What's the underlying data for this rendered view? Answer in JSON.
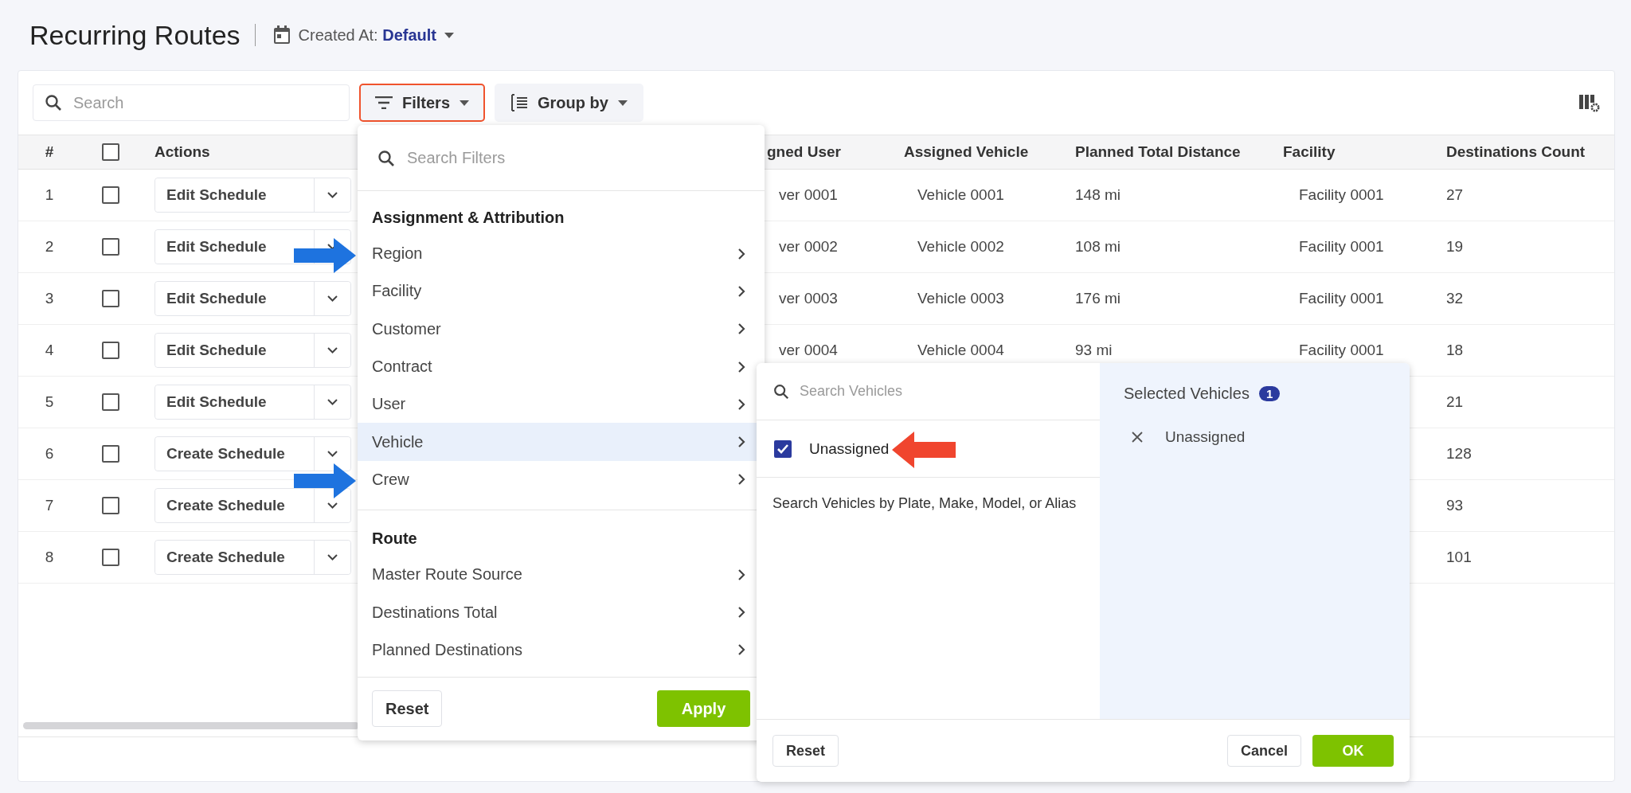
{
  "page": {
    "title": "Recurring Routes",
    "created_at": {
      "label": "Created At:",
      "value": "Default"
    }
  },
  "toolbar": {
    "search": {
      "placeholder": "Search"
    },
    "filters": {
      "label": "Filters",
      "open": true
    },
    "group_by": {
      "label": "Group by",
      "open": false
    }
  },
  "table": {
    "columns": [
      {
        "kind": "text",
        "label": "#"
      },
      {
        "kind": "checkbox",
        "checked": false
      },
      {
        "kind": "text",
        "label": "Actions"
      },
      {
        "kind": "gap"
      },
      {
        "kind": "text",
        "label": "gned User"
      },
      {
        "kind": "text",
        "label": "Assigned Vehicle"
      },
      {
        "kind": "text",
        "label": "Planned Total Distance"
      },
      {
        "kind": "text",
        "label": "Facility"
      },
      {
        "kind": "text",
        "label": "Destinations Count"
      }
    ],
    "rows": [
      {
        "number": "1",
        "checked": false,
        "action": "Edit Schedule",
        "assigned_user": "ver 0001",
        "assigned_vehicle": "Vehicle 0001",
        "planned_total_distance": "148 mi",
        "facility": "Facility 0001",
        "destinations_count": "27"
      },
      {
        "number": "2",
        "checked": false,
        "action": "Edit Schedule",
        "assigned_user": "ver 0002",
        "assigned_vehicle": "Vehicle 0002",
        "planned_total_distance": "108 mi",
        "facility": "Facility 0001",
        "destinations_count": "19"
      },
      {
        "number": "3",
        "checked": false,
        "action": "Edit Schedule",
        "assigned_user": "ver 0003",
        "assigned_vehicle": "Vehicle 0003",
        "planned_total_distance": "176 mi",
        "facility": "Facility 0001",
        "destinations_count": "32"
      },
      {
        "number": "4",
        "checked": false,
        "action": "Edit Schedule",
        "assigned_user": "ver 0004",
        "assigned_vehicle": "Vehicle 0004",
        "planned_total_distance": "93 mi",
        "facility": "Facility 0001",
        "destinations_count": "18"
      },
      {
        "number": "5",
        "checked": false,
        "action": "Edit Schedule",
        "destinations_count": "21"
      },
      {
        "number": "6",
        "checked": false,
        "action": "Create Schedule",
        "destinations_count": "128"
      },
      {
        "number": "7",
        "checked": false,
        "action": "Create Schedule",
        "destinations_count": "93"
      },
      {
        "number": "8",
        "checked": false,
        "action": "Create Schedule",
        "destinations_count": "101"
      }
    ]
  },
  "filter_menu": {
    "search": {
      "placeholder": "Search Filters"
    },
    "groups": [
      {
        "heading": "Assignment & Attribution",
        "items": [
          {
            "label": "Region",
            "selected": false
          },
          {
            "label": "Facility",
            "selected": false
          },
          {
            "label": "Customer",
            "selected": false
          },
          {
            "label": "Contract",
            "selected": false
          },
          {
            "label": "User",
            "selected": false
          },
          {
            "label": "Vehicle",
            "selected": true
          },
          {
            "label": "Crew",
            "selected": false
          }
        ]
      },
      {
        "heading": "Route",
        "items": [
          {
            "label": "Master Route Source",
            "selected": false
          },
          {
            "label": "Destinations Total",
            "selected": false
          },
          {
            "label": "Planned Destinations",
            "selected": false
          }
        ]
      }
    ],
    "buttons": {
      "reset": "Reset",
      "apply": "Apply"
    }
  },
  "vehicle_panel": {
    "search": {
      "placeholder": "Search Vehicles"
    },
    "options": [
      {
        "label": "Unassigned",
        "checked": true
      }
    ],
    "hint": "Search Vehicles by Plate, Make, Model, or Alias",
    "selected_title": "Selected Vehicles",
    "selected_count": "1",
    "selected": [
      {
        "label": "Unassigned"
      }
    ],
    "buttons": {
      "reset": "Reset",
      "cancel": "Cancel",
      "ok": "OK"
    }
  }
}
